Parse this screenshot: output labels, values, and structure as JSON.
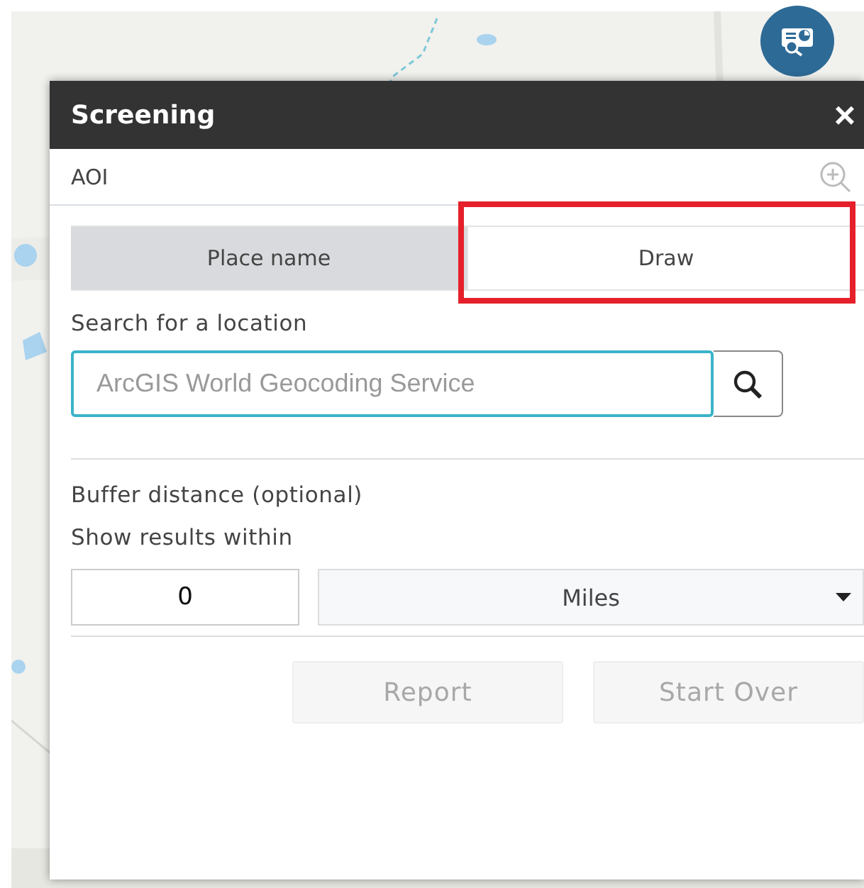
{
  "panel": {
    "title": "Screening",
    "close": "×"
  },
  "aoi": {
    "label": "AOI"
  },
  "tabs": [
    {
      "label": "Place name",
      "selected": true,
      "highlighted": false
    },
    {
      "label": "Draw",
      "selected": false,
      "highlighted": true
    }
  ],
  "search": {
    "label": "Search for a location",
    "placeholder": "ArcGIS World Geocoding Service"
  },
  "buffer": {
    "label": "Buffer distance (optional)",
    "sublabel": "Show results within",
    "value": "0",
    "unit": "Miles"
  },
  "buttons": [
    {
      "label": "Report",
      "disabled": true
    },
    {
      "label": "Start Over",
      "disabled": true
    }
  ]
}
